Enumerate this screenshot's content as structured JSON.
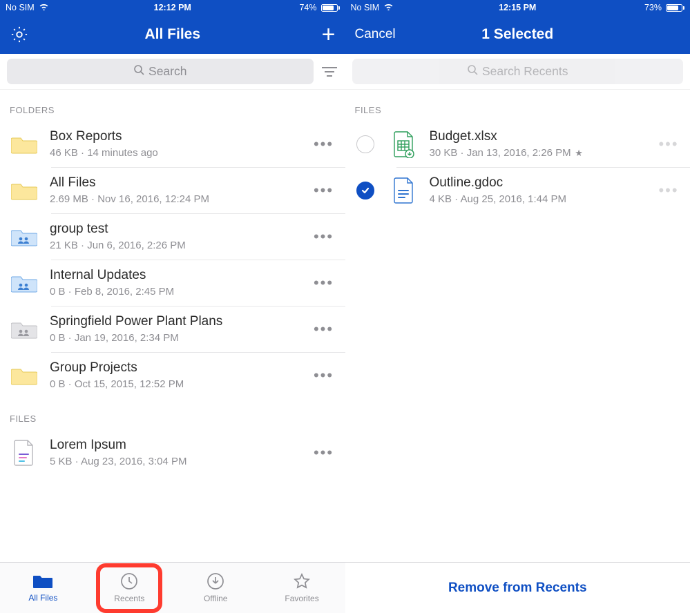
{
  "left": {
    "status": {
      "carrier": "No SIM",
      "time": "12:12 PM",
      "battery_pct": "74%",
      "battery_fill": 74
    },
    "header": {
      "title": "All Files"
    },
    "search": {
      "placeholder": "Search"
    },
    "sections": {
      "folders_label": "FOLDERS",
      "files_label": "FILES"
    },
    "folders": [
      {
        "name": "Box Reports",
        "sub": "46 KB · 14 minutes ago",
        "icon": "folder-yellow"
      },
      {
        "name": "All Files",
        "sub": "2.69 MB · Nov 16, 2016, 12:24 PM",
        "icon": "folder-yellow"
      },
      {
        "name": "group test",
        "sub": "21 KB · Jun 6, 2016, 2:26 PM",
        "icon": "folder-shared"
      },
      {
        "name": "Internal Updates",
        "sub": "0 B · Feb 8, 2016, 2:45 PM",
        "icon": "folder-shared"
      },
      {
        "name": "Springfield Power Plant Plans",
        "sub": "0 B · Jan 19, 2016, 2:34 PM",
        "icon": "folder-gray"
      },
      {
        "name": "Group Projects",
        "sub": "0 B · Oct 15, 2015, 12:52 PM",
        "icon": "folder-yellow"
      }
    ],
    "files": [
      {
        "name": "Lorem Ipsum",
        "sub": "5 KB · Aug 23, 2016, 3:04 PM",
        "icon": "file-doc"
      }
    ],
    "tabs": [
      {
        "label": "All Files"
      },
      {
        "label": "Recents"
      },
      {
        "label": "Offline"
      },
      {
        "label": "Favorites"
      }
    ]
  },
  "right": {
    "status": {
      "carrier": "No SIM",
      "time": "12:15 PM",
      "battery_pct": "73%",
      "battery_fill": 73
    },
    "header": {
      "cancel": "Cancel",
      "title": "1 Selected"
    },
    "search": {
      "placeholder": "Search Recents"
    },
    "files_label": "FILES",
    "files": [
      {
        "name": "Budget.xlsx",
        "sub": "30 KB · Jan 13, 2016, 2:26 PM",
        "starred": true,
        "selected": false,
        "icon": "file-xlsx"
      },
      {
        "name": "Outline.gdoc",
        "sub": "4 KB · Aug 25, 2016, 1:44 PM",
        "starred": false,
        "selected": true,
        "icon": "file-gdoc"
      }
    ],
    "bottom_action": "Remove from Recents"
  }
}
